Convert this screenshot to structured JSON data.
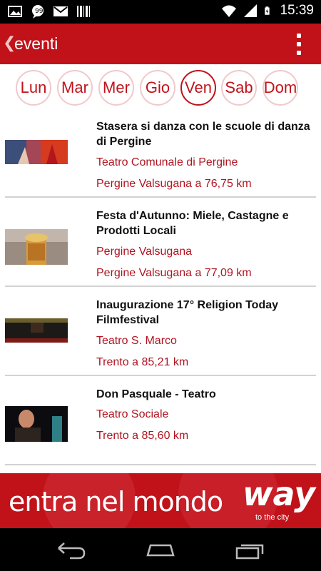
{
  "status_bar": {
    "time": "15:39",
    "icons": [
      "image-icon",
      "chat-icon",
      "gmail-icon",
      "barcode-icon",
      "wifi-icon",
      "signal-icon",
      "battery-charging-icon"
    ]
  },
  "app_bar": {
    "title": "eventi",
    "back_glyph": "❮",
    "menu_icon": "overflow-menu-icon"
  },
  "days": [
    {
      "label": "Lun",
      "active": false
    },
    {
      "label": "Mar",
      "active": false
    },
    {
      "label": "Mer",
      "active": false
    },
    {
      "label": "Gio",
      "active": false
    },
    {
      "label": "Ven",
      "active": true
    },
    {
      "label": "Sab",
      "active": false
    },
    {
      "label": "Dom",
      "active": false
    }
  ],
  "events": [
    {
      "title": "Stasera si danza con le scuole di danza di Pergine",
      "place": "Teatro Comunale di Pergine",
      "distance": "Pergine Valsugana a 76,75 km"
    },
    {
      "title": "Festa d'Autunno: Miele, Castagne e Prodotti Locali",
      "place": "Pergine Valsugana",
      "distance": "Pergine Valsugana a 77,09 km"
    },
    {
      "title": "Inaugurazione 17° Religion Today Filmfestival",
      "place": "Teatro S. Marco",
      "distance": "Trento a 85,21 km"
    },
    {
      "title": "Don Pasquale - Teatro",
      "place": "Teatro Sociale",
      "distance": "Trento a 85,60 km"
    }
  ],
  "banner": {
    "slogan": "entra nel mondo",
    "logo": "way",
    "logo_sub": "to the city"
  },
  "nav_bar": {
    "icons": [
      "back-icon",
      "home-icon",
      "recents-icon"
    ]
  },
  "colors": {
    "accent": "#c1121a",
    "accent_text": "#b01420"
  }
}
